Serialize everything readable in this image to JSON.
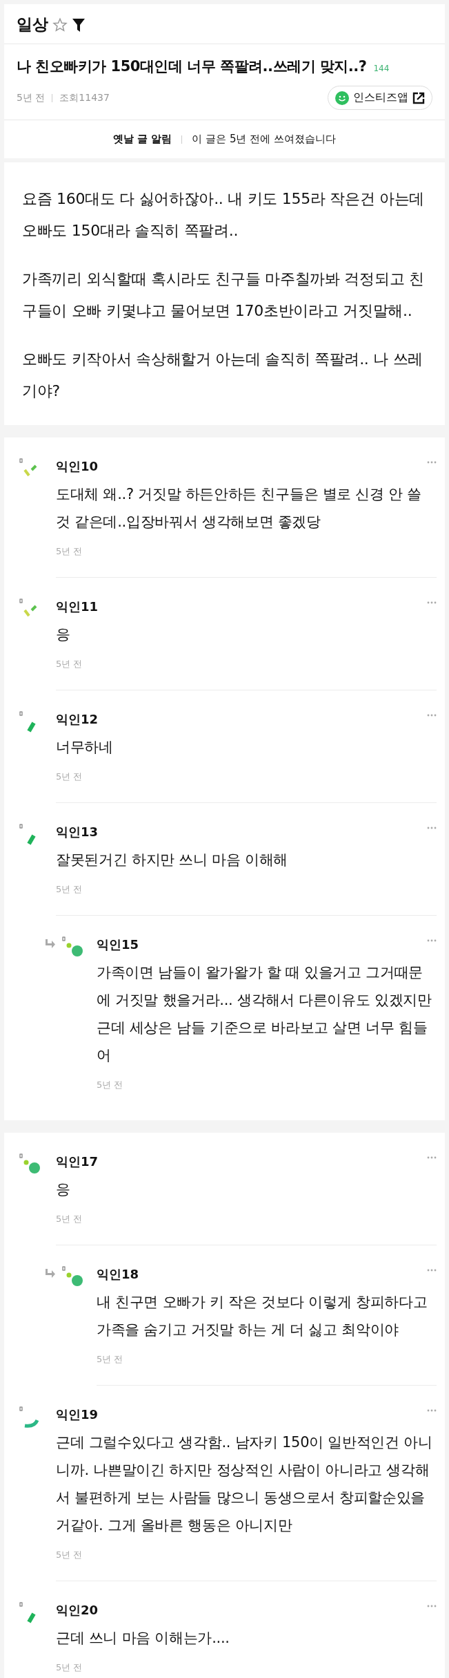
{
  "board": {
    "name": "일상"
  },
  "post": {
    "title": "나 친오빠키가 150대인데 너무 쪽팔려..쓰레기 맞지..?",
    "comment_count": "144",
    "age": "5년 전",
    "views": "조회11437",
    "app_button": "인스티즈앱"
  },
  "notice": {
    "label": "옛날 글 알림",
    "text": "이 글은 5년 전에 쓰여졌습니다"
  },
  "body": [
    "요즘 160대도 다 싫어하잖아.. 내 키도 155라 작은건 아는데 오빠도 150대라 솔직히 쪽팔려..",
    "가족끼리 외식할때 혹시라도 친구들 마주칠까봐 걱정되고 친구들이 오빠 키몇냐고 물어보면 170초반이라고 거짓말해..",
    "오빠도 키작아서 속상해할거 아는데 솔직히 쪽팔려.. 나 쓰레기야?"
  ],
  "comment_groups": [
    [
      {
        "author": "익인10",
        "text": "도대체 왜..? 거짓말 하든안하든 친구들은 별로 신경 안 쓸 것 같은데..입장바꿔서 생각해보면 좋겠당",
        "time": "5년 전",
        "reply": false,
        "kind": "twin-slash"
      },
      {
        "author": "익인11",
        "text": "응",
        "time": "5년 전",
        "reply": false,
        "kind": "twin-slash"
      },
      {
        "author": "익인12",
        "text": "너무하네",
        "time": "5년 전",
        "reply": false,
        "kind": "slash"
      },
      {
        "author": "익인13",
        "text": "잘못된거긴 하지만 쓰니 마음 이해해",
        "time": "5년 전",
        "reply": false,
        "kind": "slash"
      },
      {
        "author": "익인15",
        "text": "가족이면 남들이 왈가왈가 할 때 있을거고 그거때문에 거짓말 했을거라... 생각해서 다른이유도 있겠지만 근데 세상은 남들 기준으로 바라보고 살면 너무 힘들어",
        "time": "5년 전",
        "reply": true,
        "kind": "dots"
      }
    ],
    [
      {
        "author": "익인17",
        "text": "응",
        "time": "5년 전",
        "reply": false,
        "kind": "dots"
      },
      {
        "author": "익인18",
        "text": "내 친구면 오빠가 키 작은 것보다 이렇게 창피하다고 가족을 숨기고 거짓말 하는 게 더 싫고 최악이야",
        "time": "5년 전",
        "reply": true,
        "kind": "dots"
      },
      {
        "author": "익인19",
        "text": "근데 그럴수있다고 생각함.. 남자키 150이 일반적인건 아니니까. 나쁜말이긴 하지만 정상적인 사람이 아니라고 생각해서 불편하게 보는 사람들 많으니 동생으로서 창피할순있을거같아. 그게 올바른 행동은 아니지만",
        "time": "5년 전",
        "reply": false,
        "kind": "arc"
      },
      {
        "author": "익인20",
        "text": "근데 쓰니 마음 이해는가....",
        "time": "5년 전",
        "reply": false,
        "kind": "slash"
      }
    ]
  ]
}
